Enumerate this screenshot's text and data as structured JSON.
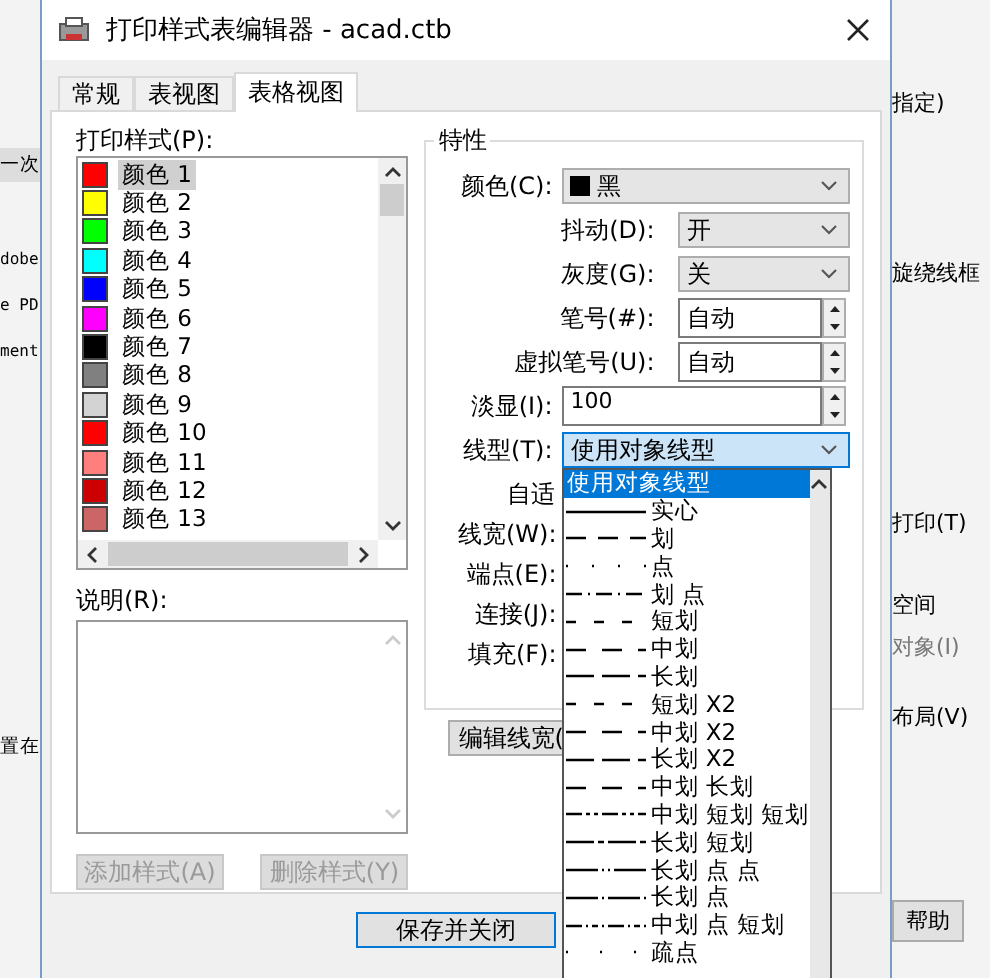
{
  "background_left": [
    "一次",
    "dobe",
    "e PD",
    "ment",
    "置在"
  ],
  "background_right": [
    "指定)",
    "旋绕线框",
    "打印(T)",
    "空间",
    "对象(I)",
    "布局(V)",
    "帮助"
  ],
  "window": {
    "title": "打印样式表编辑器 - acad.ctb"
  },
  "tabs": [
    {
      "label": "常规",
      "selected": false
    },
    {
      "label": "表视图",
      "selected": false
    },
    {
      "label": "表格视图",
      "selected": true
    }
  ],
  "styles_label": "打印样式(P):",
  "styles": [
    {
      "label": "颜色",
      "number": "1",
      "color": "#ff0000",
      "selected": true
    },
    {
      "label": "颜色",
      "number": "2",
      "color": "#ffff00",
      "selected": false
    },
    {
      "label": "颜色",
      "number": "3",
      "color": "#00ff00",
      "selected": false
    },
    {
      "label": "颜色",
      "number": "4",
      "color": "#00ffff",
      "selected": false
    },
    {
      "label": "颜色",
      "number": "5",
      "color": "#0000ff",
      "selected": false
    },
    {
      "label": "颜色",
      "number": "6",
      "color": "#ff00ff",
      "selected": false
    },
    {
      "label": "颜色",
      "number": "7",
      "color": "#000000",
      "selected": false
    },
    {
      "label": "颜色",
      "number": "8",
      "color": "#808080",
      "selected": false
    },
    {
      "label": "颜色",
      "number": "9",
      "color": "#d3d3d3",
      "selected": false
    },
    {
      "label": "颜色",
      "number": "10",
      "color": "#ff0000",
      "selected": false
    },
    {
      "label": "颜色",
      "number": "11",
      "color": "#ff7f7f",
      "selected": false
    },
    {
      "label": "颜色",
      "number": "12",
      "color": "#cc0000",
      "selected": false
    },
    {
      "label": "颜色",
      "number": "13",
      "color": "#cc6666",
      "selected": false
    }
  ],
  "description_label": "说明(R):",
  "style_buttons": [
    {
      "label": "添加样式(A)",
      "disabled": true
    },
    {
      "label": "删除样式(Y)",
      "disabled": true
    }
  ],
  "properties": {
    "title": "特性",
    "rows": [
      {
        "kind": "color",
        "label": "颜色(C):",
        "value": "黑",
        "color": "#000000"
      },
      {
        "kind": "dropdown",
        "label": "抖动(D):",
        "value": "开"
      },
      {
        "kind": "dropdown",
        "label": "灰度(G):",
        "value": "关"
      },
      {
        "kind": "spinner",
        "label": "笔号(#):",
        "value": "自动"
      },
      {
        "kind": "spinner",
        "label": "虚拟笔号(U):",
        "value": "自动"
      },
      {
        "kind": "wide_spinner",
        "label": "淡显(I):",
        "value": "100"
      },
      {
        "kind": "open_dropdown",
        "label": "线型(T):",
        "value": "使用对象线型"
      }
    ],
    "covered_labels": [
      "自适",
      "线宽(W):",
      "端点(E):",
      "连接(J):",
      "填充(F):"
    ],
    "edit_button": "编辑线宽(",
    "linetype_options": [
      {
        "label": "使用对象线型",
        "kind": "none",
        "selected": true
      },
      {
        "label": "实心",
        "kind": "solid",
        "selected": false
      },
      {
        "label": "划",
        "kind": "dash",
        "selected": false
      },
      {
        "label": "点",
        "kind": "dot",
        "selected": false
      },
      {
        "label": "划 点",
        "kind": "dashdot",
        "selected": false
      },
      {
        "label": "短划",
        "kind": "short",
        "selected": false
      },
      {
        "label": "中划",
        "kind": "medium",
        "selected": false
      },
      {
        "label": "长划",
        "kind": "long",
        "selected": false
      },
      {
        "label": "短划 X2",
        "kind": "short",
        "selected": false
      },
      {
        "label": "中划 X2",
        "kind": "medium",
        "selected": false
      },
      {
        "label": "长划 X2",
        "kind": "long",
        "selected": false
      },
      {
        "label": "中划 长划",
        "kind": "medium",
        "selected": false
      },
      {
        "label": "中划 短划 短划",
        "kind": "medshort",
        "selected": false
      },
      {
        "label": "长划 短划",
        "kind": "longshort",
        "selected": false
      },
      {
        "label": "长划 点 点",
        "kind": "longdotdot",
        "selected": false
      },
      {
        "label": "长划 点",
        "kind": "longdot",
        "selected": false
      },
      {
        "label": "中划 点 短划",
        "kind": "meddotshort",
        "selected": false
      },
      {
        "label": "疏点",
        "kind": "sparse",
        "selected": false
      }
    ]
  },
  "save_button": "保存并关闭"
}
